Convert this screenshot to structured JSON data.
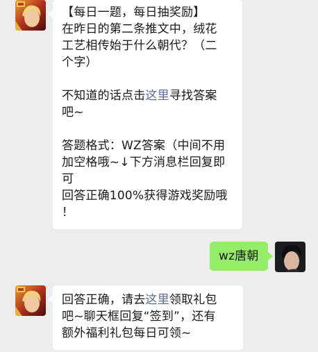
{
  "colors": {
    "background": "#ededed",
    "incoming_bubble": "#ffffff",
    "outgoing_bubble": "#95ec69",
    "link": "#576b95",
    "text": "#191919"
  },
  "messages": [
    {
      "sender": "official-account",
      "avatar_icon": "game-hero-avatar",
      "lines": [
        {
          "parts": [
            {
              "text": "【每日一题，每日抽奖励】"
            }
          ]
        },
        {
          "parts": [
            {
              "text": "在昨日的第二条推文中，绒花"
            }
          ]
        },
        {
          "parts": [
            {
              "text": "工艺相传始于什么朝代？（二"
            }
          ]
        },
        {
          "parts": [
            {
              "text": "个字）"
            }
          ]
        },
        {
          "blank": true
        },
        {
          "parts": [
            {
              "text": "不知道的话点击"
            },
            {
              "text": "这里",
              "link": true
            },
            {
              "text": "寻找答案"
            }
          ]
        },
        {
          "parts": [
            {
              "text": "吧~"
            }
          ]
        },
        {
          "blank": true
        },
        {
          "parts": [
            {
              "text": "答题格式：WZ答案（中间不用"
            }
          ]
        },
        {
          "parts": [
            {
              "text": "加空格哦~↓下方消息栏回复即"
            }
          ]
        },
        {
          "parts": [
            {
              "text": "可"
            }
          ]
        },
        {
          "parts": [
            {
              "text": "回答正确100%获得游戏奖励哦"
            }
          ]
        },
        {
          "parts": [
            {
              "text": "！"
            }
          ]
        }
      ]
    },
    {
      "sender": "user",
      "avatar_icon": "user-portrait-avatar",
      "text": "wz唐朝"
    },
    {
      "sender": "official-account",
      "avatar_icon": "game-hero-avatar",
      "lines": [
        {
          "parts": [
            {
              "text": "回答正确，请去"
            },
            {
              "text": "这里",
              "link": true
            },
            {
              "text": "领取礼包"
            }
          ]
        },
        {
          "parts": [
            {
              "text": "吧~聊天框回复“签到”，还有"
            }
          ]
        },
        {
          "parts": [
            {
              "text": "额外福利礼包每日可领~"
            }
          ]
        }
      ]
    }
  ]
}
